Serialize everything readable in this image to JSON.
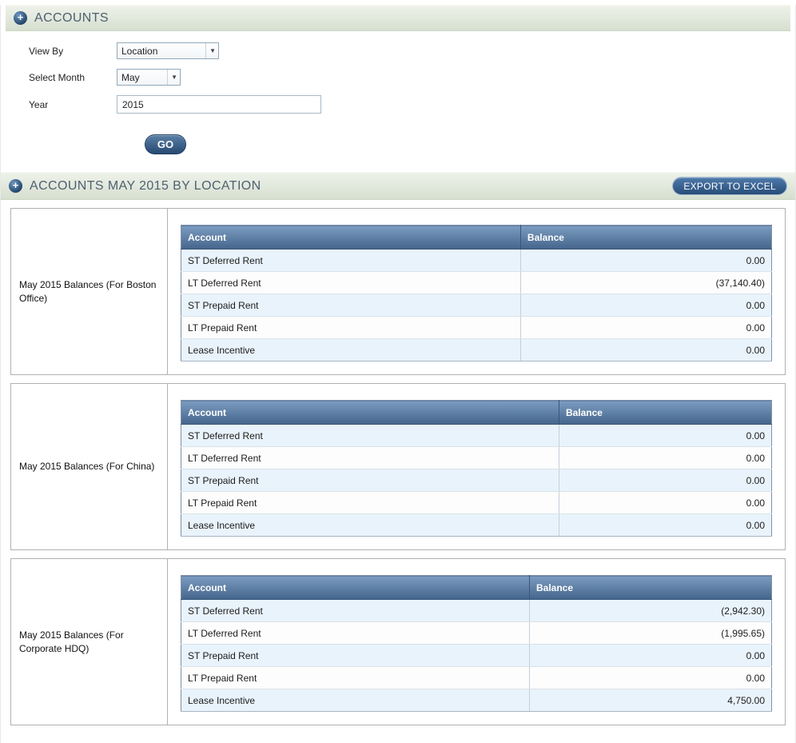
{
  "accounts_section": {
    "title": "ACCOUNTS",
    "view_by": {
      "label": "View By",
      "value": "Location"
    },
    "select_month": {
      "label": "Select Month",
      "value": "May"
    },
    "year": {
      "label": "Year",
      "value": "2015"
    },
    "go_button": "GO"
  },
  "results_section": {
    "title": "ACCOUNTS MAY 2015 BY LOCATION",
    "export_button": "EXPORT TO EXCEL",
    "columns": [
      "Account",
      "Balance"
    ],
    "panels": [
      {
        "label": "May 2015 Balances (For Boston Office)",
        "rows": [
          {
            "account": "ST Deferred Rent",
            "balance": "0.00"
          },
          {
            "account": "LT Deferred Rent",
            "balance": "(37,140.40)"
          },
          {
            "account": "ST Prepaid Rent",
            "balance": "0.00"
          },
          {
            "account": "LT Prepaid Rent",
            "balance": "0.00"
          },
          {
            "account": "Lease Incentive",
            "balance": "0.00"
          }
        ]
      },
      {
        "label": "May 2015 Balances (For China)",
        "rows": [
          {
            "account": "ST Deferred Rent",
            "balance": "0.00"
          },
          {
            "account": "LT Deferred Rent",
            "balance": "0.00"
          },
          {
            "account": "ST Prepaid Rent",
            "balance": "0.00"
          },
          {
            "account": "LT Prepaid Rent",
            "balance": "0.00"
          },
          {
            "account": "Lease Incentive",
            "balance": "0.00"
          }
        ]
      },
      {
        "label": "May 2015 Balances (For Corporate HDQ)",
        "rows": [
          {
            "account": "ST Deferred Rent",
            "balance": "(2,942.30)"
          },
          {
            "account": "LT Deferred Rent",
            "balance": "(1,995.65)"
          },
          {
            "account": "ST Prepaid Rent",
            "balance": "0.00"
          },
          {
            "account": "LT Prepaid Rent",
            "balance": "0.00"
          },
          {
            "account": "Lease Incentive",
            "balance": "4,750.00"
          }
        ]
      }
    ]
  },
  "colors": {
    "header_bar_green": "#dce4d4",
    "table_header_blue": "#44658c",
    "button_blue": "#2a4d77",
    "row_alt_blue": "#e9f3fb"
  }
}
